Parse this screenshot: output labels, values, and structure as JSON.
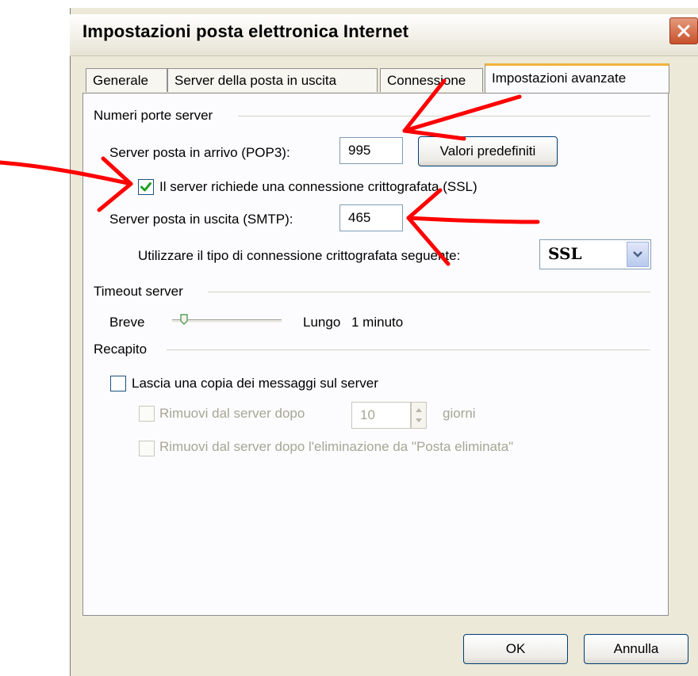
{
  "window": {
    "title": "Impostazioni posta elettronica Internet"
  },
  "tabs": [
    {
      "label": "Generale"
    },
    {
      "label": "Server della posta in uscita"
    },
    {
      "label": "Connessione"
    },
    {
      "label": "Impostazioni avanzate",
      "active": true
    }
  ],
  "ports": {
    "group_label": "Numeri porte server",
    "incoming_label": "Server posta in arrivo (POP3):",
    "incoming_value": "995",
    "defaults_button": "Valori predefiniti",
    "ssl_checkbox_label": "Il server richiede una connessione crittografata (SSL)",
    "ssl_checked": true,
    "outgoing_label": "Server posta in uscita (SMTP):",
    "outgoing_value": "465",
    "encryption_label": "Utilizzare il tipo di connessione crittografata seguente:",
    "encryption_value": "SSL"
  },
  "timeout": {
    "group_label": "Timeout server",
    "short_label": "Breve",
    "long_label": "Lungo",
    "value_text": "1 minuto",
    "slider_level": 0.1
  },
  "delivery": {
    "group_label": "Recapito",
    "leave_copy_label": "Lascia una copia dei messaggi sul server",
    "leave_copy_checked": false,
    "remove_after_label": "Rimuovi dal server dopo",
    "remove_after_days": "10",
    "days_label": "giorni",
    "remove_deleted_label": "Rimuovi dal server dopo l'eliminazione da \"Posta eliminata\""
  },
  "buttons": {
    "ok": "OK",
    "cancel": "Annulla"
  },
  "colors": {
    "annotation_arrows": "#ff0000",
    "active_tab_accent": "#f2b33d",
    "check_mark": "#21a121"
  }
}
